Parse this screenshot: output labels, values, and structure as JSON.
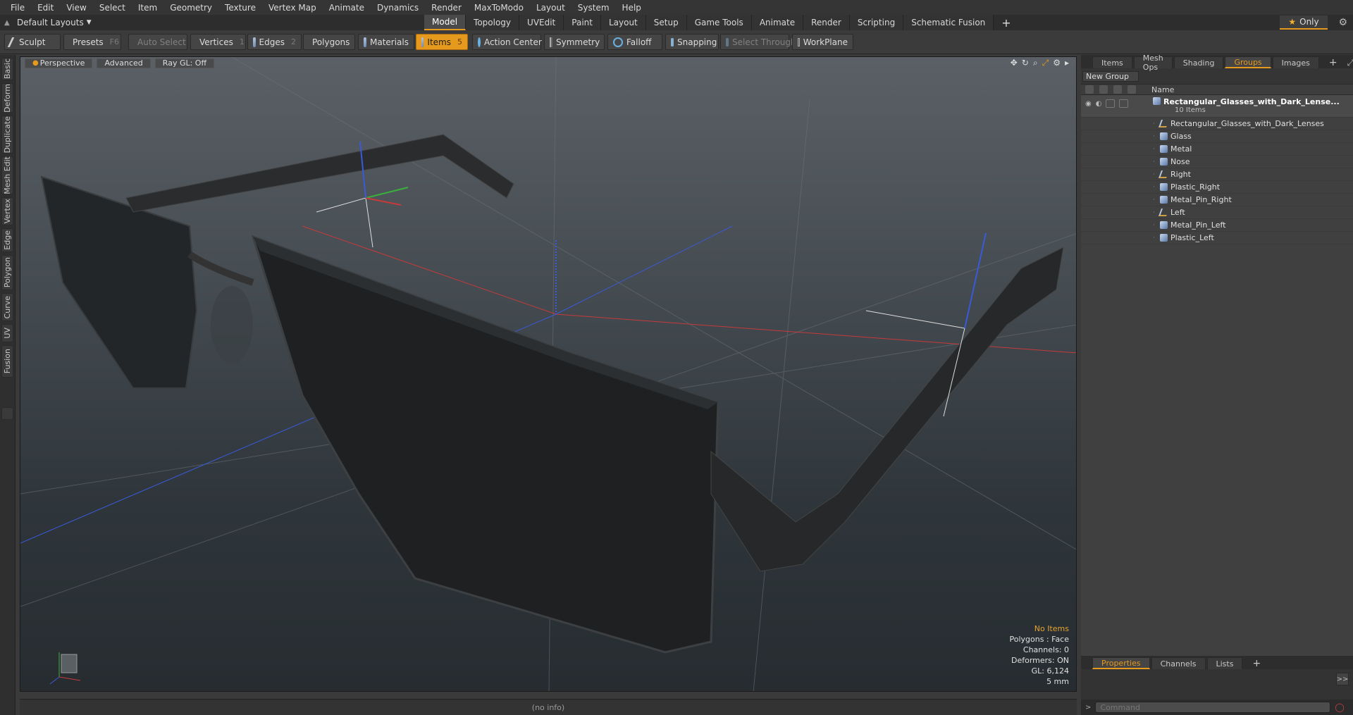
{
  "menu": [
    "File",
    "Edit",
    "View",
    "Select",
    "Item",
    "Geometry",
    "Texture",
    "Vertex Map",
    "Animate",
    "Dynamics",
    "Render",
    "MaxToModo",
    "Layout",
    "System",
    "Help"
  ],
  "layout": {
    "label": "Default Layouts"
  },
  "tabs": [
    "Model",
    "Topology",
    "UVEdit",
    "Paint",
    "Layout",
    "Setup",
    "Game Tools",
    "Animate",
    "Render",
    "Scripting",
    "Schematic Fusion"
  ],
  "only_label": "Only",
  "toolbar": {
    "sculpt": "Sculpt",
    "presets": "Presets",
    "presets_key": "F6",
    "auto_select": "Auto Select",
    "vertices": "Vertices",
    "vertices_key": "1",
    "edges": "Edges",
    "edges_key": "2",
    "polygons": "Polygons",
    "materials": "Materials",
    "items": "Items",
    "items_key": "5",
    "action_center": "Action Center",
    "symmetry": "Symmetry",
    "falloff": "Falloff",
    "snapping": "Snapping",
    "select_through": "Select Through",
    "workplane": "WorkPlane"
  },
  "left_tabs": [
    "Basic",
    "Deform",
    "Duplicate",
    "Mesh Edit",
    "Vertex",
    "Edge",
    "Polygon",
    "Curve",
    "UV",
    "Fusion"
  ],
  "viewport": {
    "view": "Perspective",
    "mode": "Advanced",
    "raygl": "Ray GL: Off",
    "info": [
      "No Items",
      "Polygons : Face",
      "Channels: 0",
      "Deformers: ON",
      "GL: 6,124",
      "5 mm"
    ]
  },
  "status": "(no info)",
  "right_tabs": [
    "Items",
    "Mesh Ops",
    "Shading",
    "Groups",
    "Images"
  ],
  "new_group": "New Group",
  "tree_header": "Name",
  "tree": {
    "group": "Rectangular_Glasses_with_Dark_Lense...",
    "count": "10 Items",
    "items": [
      {
        "name": "Rectangular_Glasses_with_Dark_Lenses",
        "type": "loc"
      },
      {
        "name": "Glass",
        "type": "mesh"
      },
      {
        "name": "Metal",
        "type": "mesh"
      },
      {
        "name": "Nose",
        "type": "mesh"
      },
      {
        "name": "Right",
        "type": "loc"
      },
      {
        "name": "Plastic_Right",
        "type": "mesh"
      },
      {
        "name": "Metal_Pin_Right",
        "type": "mesh"
      },
      {
        "name": "Left",
        "type": "loc"
      },
      {
        "name": "Metal_Pin_Left",
        "type": "mesh"
      },
      {
        "name": "Plastic_Left",
        "type": "mesh"
      }
    ]
  },
  "bottom_tabs": [
    "Properties",
    "Channels",
    "Lists"
  ],
  "command_placeholder": "Command"
}
